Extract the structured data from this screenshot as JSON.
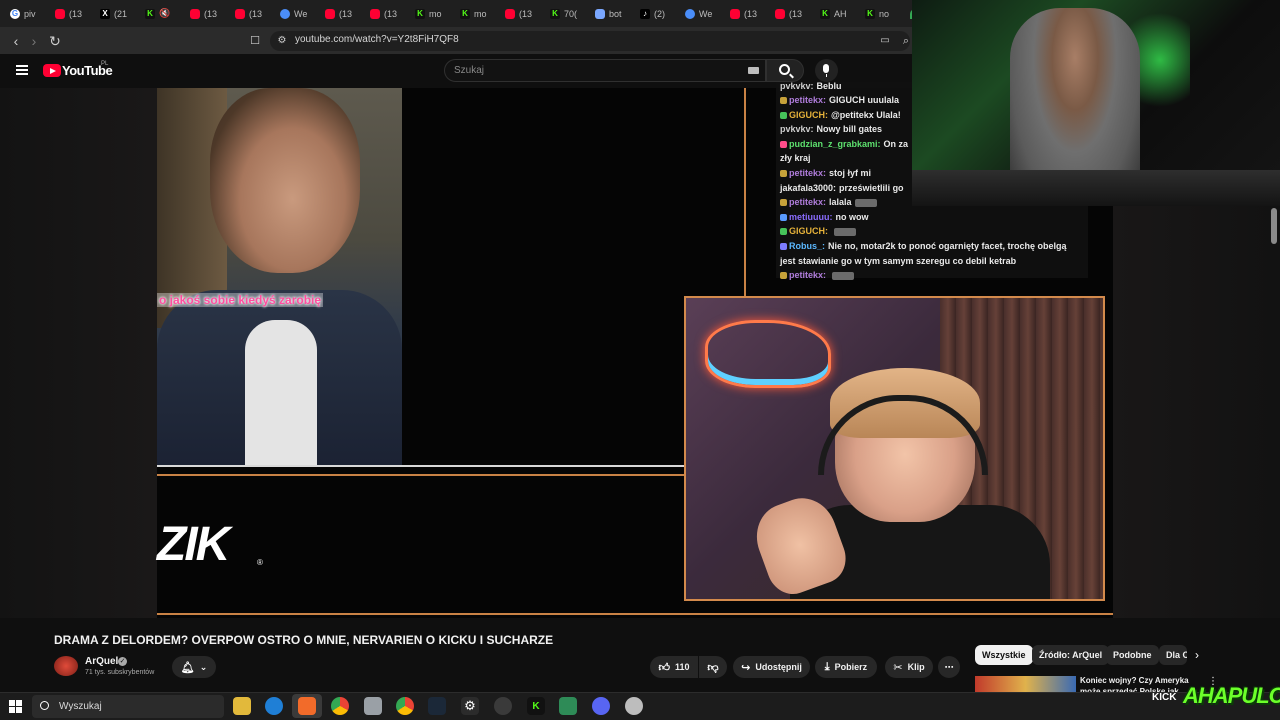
{
  "browser": {
    "tabs": [
      {
        "icon": "google-icon",
        "label": "piv"
      },
      {
        "icon": "youtube-icon",
        "label": "(13"
      },
      {
        "icon": "x-icon",
        "label": "(21"
      },
      {
        "icon": "kick-icon",
        "label": "🔇"
      },
      {
        "icon": "youtube-icon",
        "label": "(13"
      },
      {
        "icon": "youtube-icon",
        "label": "(13"
      },
      {
        "icon": "edge-icon",
        "label": "We"
      },
      {
        "icon": "youtube-icon",
        "label": "(13"
      },
      {
        "icon": "youtube-icon",
        "label": "(13"
      },
      {
        "icon": "kick-icon",
        "label": "mo"
      },
      {
        "icon": "kick-icon",
        "label": "mo"
      },
      {
        "icon": "youtube-icon",
        "label": "(13"
      },
      {
        "icon": "kick-icon",
        "label": "70("
      },
      {
        "icon": "bot-icon",
        "label": "bot"
      },
      {
        "icon": "tiktok-icon",
        "label": "(2)"
      },
      {
        "icon": "edge-icon",
        "label": "We"
      },
      {
        "icon": "youtube-icon",
        "label": "(13"
      },
      {
        "icon": "youtube-icon",
        "label": "(13"
      },
      {
        "icon": "kick-icon",
        "label": "AH"
      },
      {
        "icon": "kick-icon",
        "label": "no"
      },
      {
        "icon": "maps-icon",
        "label": "sta"
      }
    ],
    "url": "youtube.com/watch?v=Y2t8FiH7QF8"
  },
  "youtube": {
    "logo_text": "YouTube",
    "region": "PL",
    "search_placeholder": "Szukaj"
  },
  "video": {
    "subtitle": "o jakoś sobie kiedyś zarobię",
    "logo_text": "ZIK",
    "logo_reg": "®",
    "chat": [
      {
        "user": "pvkvkv:",
        "text": "Beblu",
        "color": "#cfcfcf"
      },
      {
        "user": "petitekx:",
        "text": "GIGUCH uuulala",
        "color": "#b07ddc",
        "badge": "#c7a23a"
      },
      {
        "user": "GIGUCH:",
        "text": "@petitekx Ulala!",
        "color": "#e6b23a",
        "badge": "#46c35a"
      },
      {
        "user": "pvkvkv:",
        "text": "Nowy bill gates",
        "color": "#cfcfcf"
      },
      {
        "user": "pudzian_z_grabkami:",
        "text": "On za",
        "color": "#5de06e",
        "badge": "#ff4d8a"
      },
      {
        "user": "",
        "text": "zły kraj",
        "color": "#eaeaea"
      },
      {
        "user": "petitekx:",
        "text": "stoj łyf mi",
        "color": "#b07ddc",
        "badge": "#c7a23a"
      },
      {
        "user": "jakafala3000:",
        "text": "prześwietlili go",
        "color": "#eaeaea"
      },
      {
        "user": "petitekx:",
        "text": "lalala",
        "color": "#b07ddc",
        "badge": "#c7a23a"
      },
      {
        "user": "metiuuuu:",
        "text": "no wow",
        "color": "#8a6cff",
        "badge": "#5a9bff"
      },
      {
        "user": "GIGUCH:",
        "text": "",
        "color": "#e6b23a",
        "badge": "#46c35a"
      },
      {
        "user": "Robus_:",
        "text": "Nie no, motar2k to ponoć ogarnięty facet, trochę obelgą",
        "color": "#5bb8ff",
        "badge": "#7d7dff"
      },
      {
        "user": "",
        "text": "jest stawianie go w tym samym szeregu co debil ketrab",
        "color": "#eaeaea"
      },
      {
        "user": "petitekx:",
        "text": "",
        "color": "#b07ddc",
        "badge": "#c7a23a"
      }
    ]
  },
  "watch": {
    "title": "DRAMA Z DELORDEM? OVERPOW OSTRO O MNIE, NERVARIEN O KICKU I SUCHARZE",
    "channel": "ArQuel",
    "subscribers": "71 tys. subskrybentów",
    "likes": "110",
    "share": "Udostępnij",
    "download": "Pobierz",
    "clip": "Klip",
    "more": "⋯"
  },
  "chips": [
    "Wszystkie",
    "Źródło: ArQuel",
    "Podobne",
    "Dla C"
  ],
  "recommendation": {
    "title": "Koniec wojny? Czy Ameryka może sprzedać Polskę jak",
    "more": "⋮"
  },
  "overlay": {
    "kick_small": "KICK",
    "kick_logo": "AHAPULCO"
  },
  "taskbar": {
    "search_label": "Wyszukaj"
  }
}
